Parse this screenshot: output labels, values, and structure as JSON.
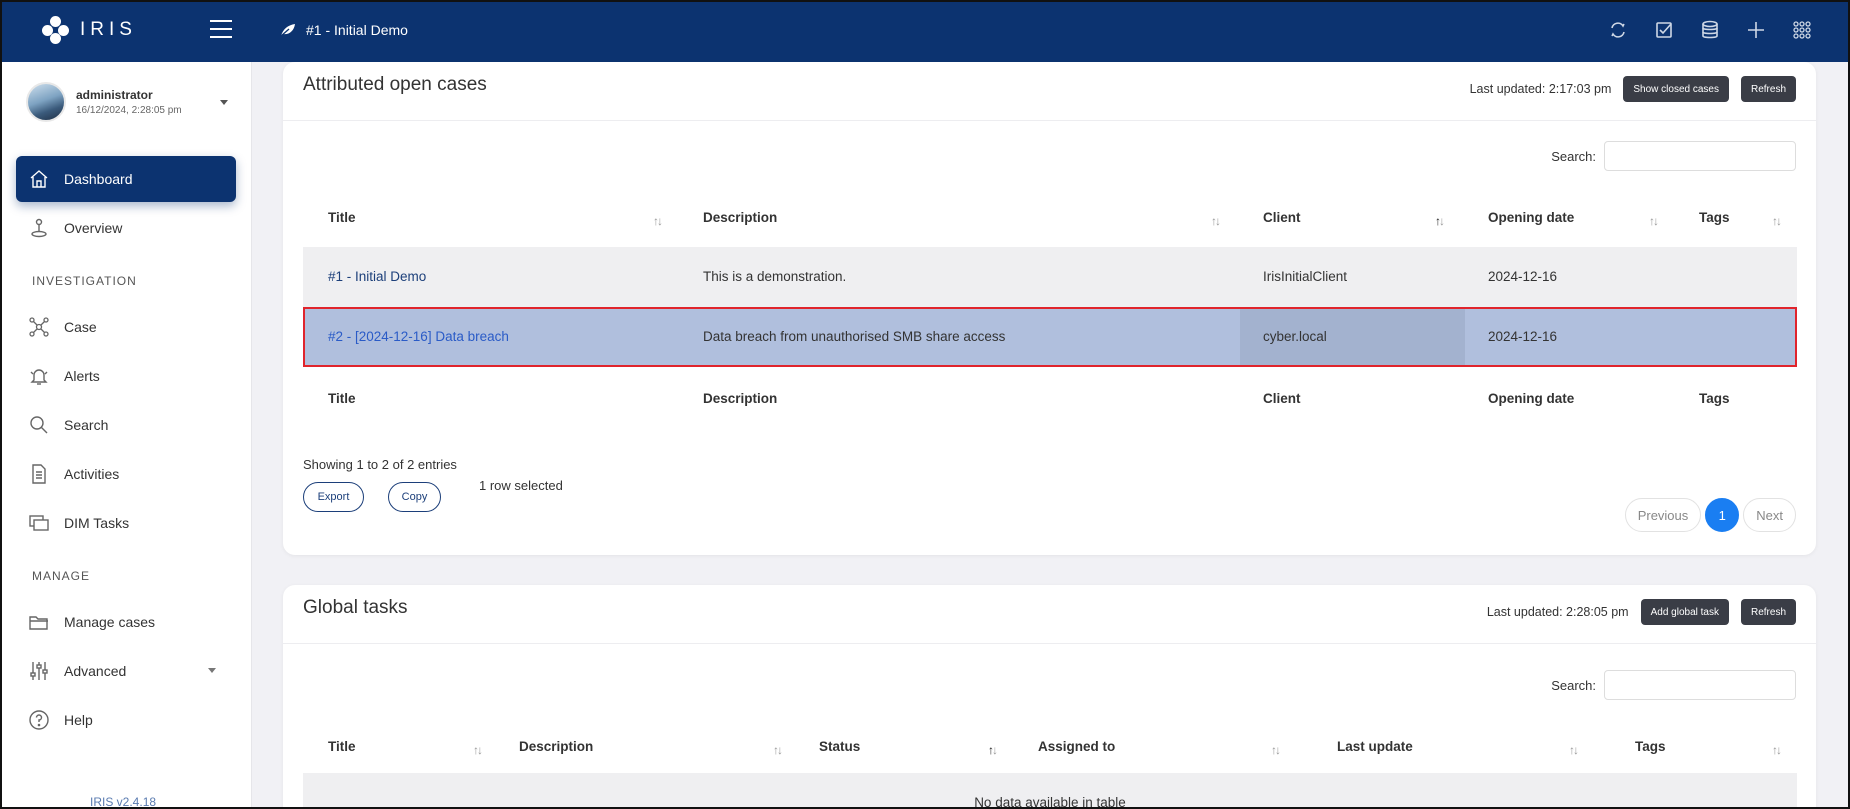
{
  "app": {
    "logo_text": "IRIS",
    "current_case": "#1 - Initial Demo"
  },
  "topbar_icons": [
    "refresh-icon",
    "checkbox-icon",
    "database-icon",
    "plus-icon",
    "grid-icon"
  ],
  "user": {
    "name": "administrator",
    "datetime": "16/12/2024, 2:28:05 pm"
  },
  "nav": {
    "dashboard": "Dashboard",
    "overview": "Overview",
    "section_investigation": "INVESTIGATION",
    "case": "Case",
    "alerts": "Alerts",
    "search": "Search",
    "activities": "Activities",
    "dim_tasks": "DIM Tasks",
    "section_manage": "MANAGE",
    "manage_cases": "Manage cases",
    "advanced": "Advanced",
    "help": "Help",
    "version": "IRIS v2.4.18"
  },
  "cases": {
    "title": "Attributed open cases",
    "last_updated": "Last updated: 2:17:03 pm",
    "show_closed_label": "Show closed cases",
    "refresh_label": "Refresh",
    "search_label": "Search:",
    "columns": [
      "Title",
      "Description",
      "Client",
      "Opening date",
      "Tags"
    ],
    "rows": [
      {
        "title": "#1 - Initial Demo",
        "description": "This is a demonstration.",
        "client": "IrisInitialClient",
        "date": "2024-12-16",
        "tags": ""
      },
      {
        "title": "#2 - [2024-12-16] Data breach",
        "description": "Data breach from unauthorised SMB share access",
        "client": "cyber.local",
        "date": "2024-12-16",
        "tags": ""
      }
    ],
    "info": "Showing 1 to 2 of 2 entries",
    "selected_info": "1 row selected",
    "export_label": "Export",
    "copy_label": "Copy",
    "pager": {
      "previous": "Previous",
      "current": "1",
      "next": "Next"
    }
  },
  "tasks": {
    "title": "Global tasks",
    "last_updated": "Last updated: 2:28:05 pm",
    "add_label": "Add global task",
    "refresh_label": "Refresh",
    "search_label": "Search:",
    "columns": [
      "Title",
      "Description",
      "Status",
      "Assigned to",
      "Last update",
      "Tags"
    ],
    "empty": "No data available in table"
  },
  "colors": {
    "topbar": "#0c3370",
    "selected_row": "#b0bfdd",
    "selected_border": "#e0242c",
    "accent": "#1a7ef2"
  }
}
